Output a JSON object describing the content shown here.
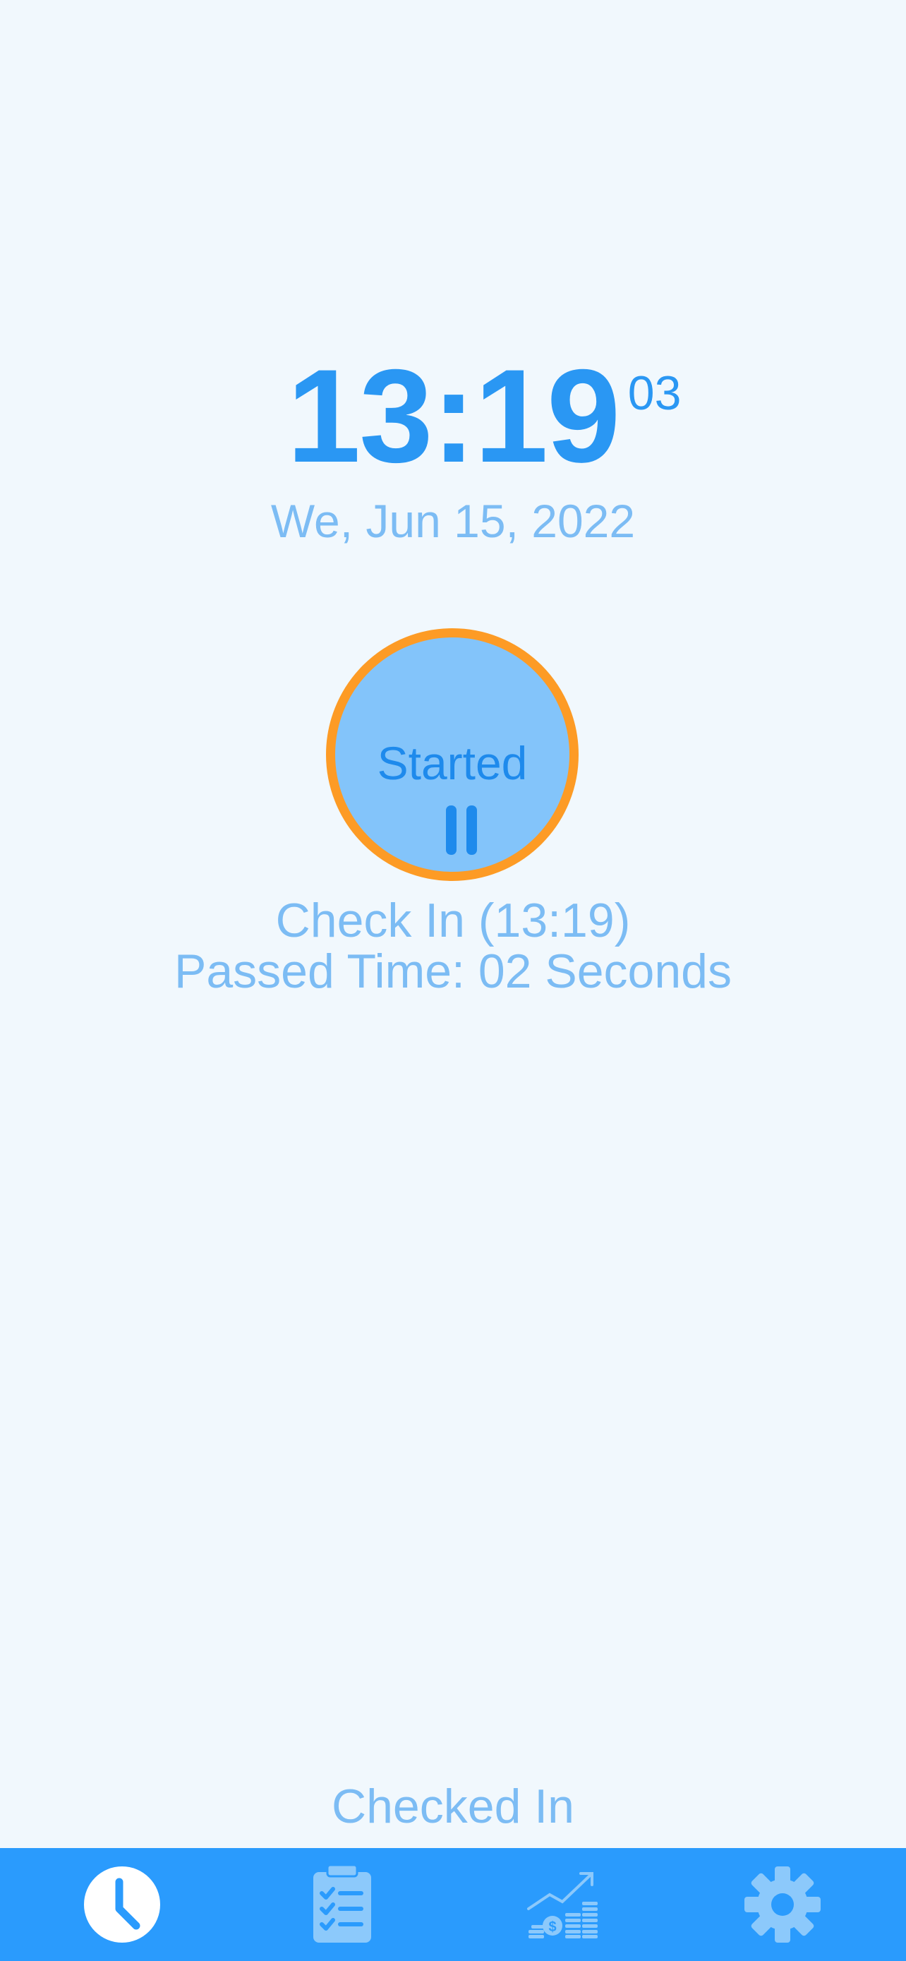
{
  "clock": {
    "time": "13:19",
    "seconds": "03",
    "date": "We, Jun 15, 2022"
  },
  "start_button": {
    "label": "Started",
    "icon": "pause-icon"
  },
  "info": {
    "check_in": "Check In (13:19)",
    "passed_time": "Passed Time: 02 Seconds"
  },
  "status": "Checked In",
  "tabs": [
    {
      "icon": "clock-icon",
      "active": true
    },
    {
      "icon": "clipboard-checklist-icon",
      "active": false
    },
    {
      "icon": "earnings-chart-icon",
      "active": false
    },
    {
      "icon": "gear-icon",
      "active": false
    }
  ],
  "colors": {
    "background": "#f1f8fd",
    "primary": "#2a97f3",
    "light_text": "#7cbcf4",
    "button_fill": "#83c4fa",
    "button_ring": "#fd9b25",
    "tab_bar": "#2a9bfd",
    "tab_icon": "#8cc9fb",
    "tab_icon_active": "#ffffff"
  }
}
